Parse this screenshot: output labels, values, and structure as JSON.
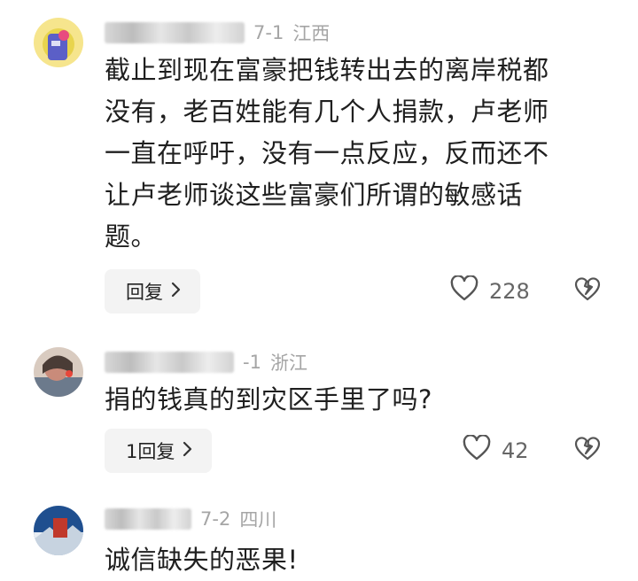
{
  "comments": [
    {
      "date": "7-1",
      "location": "江西",
      "name_partial": "",
      "lines": [
        "截止到现在富豪把钱转出去的离岸税都",
        "没有，老百姓能有几个人捐款，卢老师",
        "一直在呼吁，没有一点反应，反而还不",
        "让卢老师谈这些富豪们所谓的敏感话",
        "题。"
      ],
      "reply_label": "回复",
      "like_count": "228"
    },
    {
      "date": "-1",
      "location": "浙江",
      "lines": [
        "捐的钱真的到灾区手里了吗?"
      ],
      "reply_label": "1回复",
      "like_count": "42"
    },
    {
      "date": "7-2",
      "location": "四川",
      "lines": [
        "诚信缺失的恶果!"
      ]
    }
  ],
  "icons": {
    "like": "heart-outline-icon",
    "dislike": "broken-heart-icon",
    "chevron": "chevron-right-icon"
  },
  "colors": {
    "meta": "#a5a5a5",
    "text": "#1f1f1f",
    "reply_bg": "#f3f3f3"
  }
}
